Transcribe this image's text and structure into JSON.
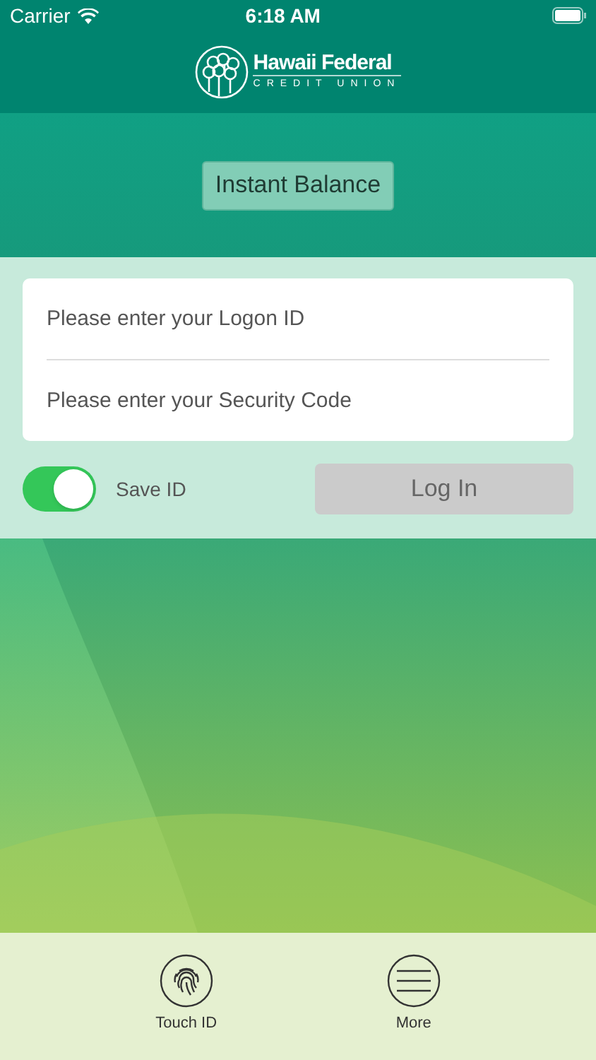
{
  "status_bar": {
    "carrier": "Carrier",
    "time": "6:18 AM"
  },
  "header": {
    "logo_name": "Hawaii Federal",
    "logo_tagline": "CREDIT UNION"
  },
  "instant_balance_button": "Instant Balance",
  "login_form": {
    "fields": [
      {
        "placeholder": "Please enter your Logon ID"
      },
      {
        "placeholder": "Please enter your Security Code"
      }
    ],
    "save_id": {
      "label": "Save ID",
      "on": true
    },
    "login_button": {
      "label": "Log In",
      "disabled": true
    }
  },
  "bottom_bar": [
    {
      "kind": "fingerprint",
      "label": "Touch ID"
    },
    {
      "kind": "menu",
      "label": "More"
    }
  ]
}
